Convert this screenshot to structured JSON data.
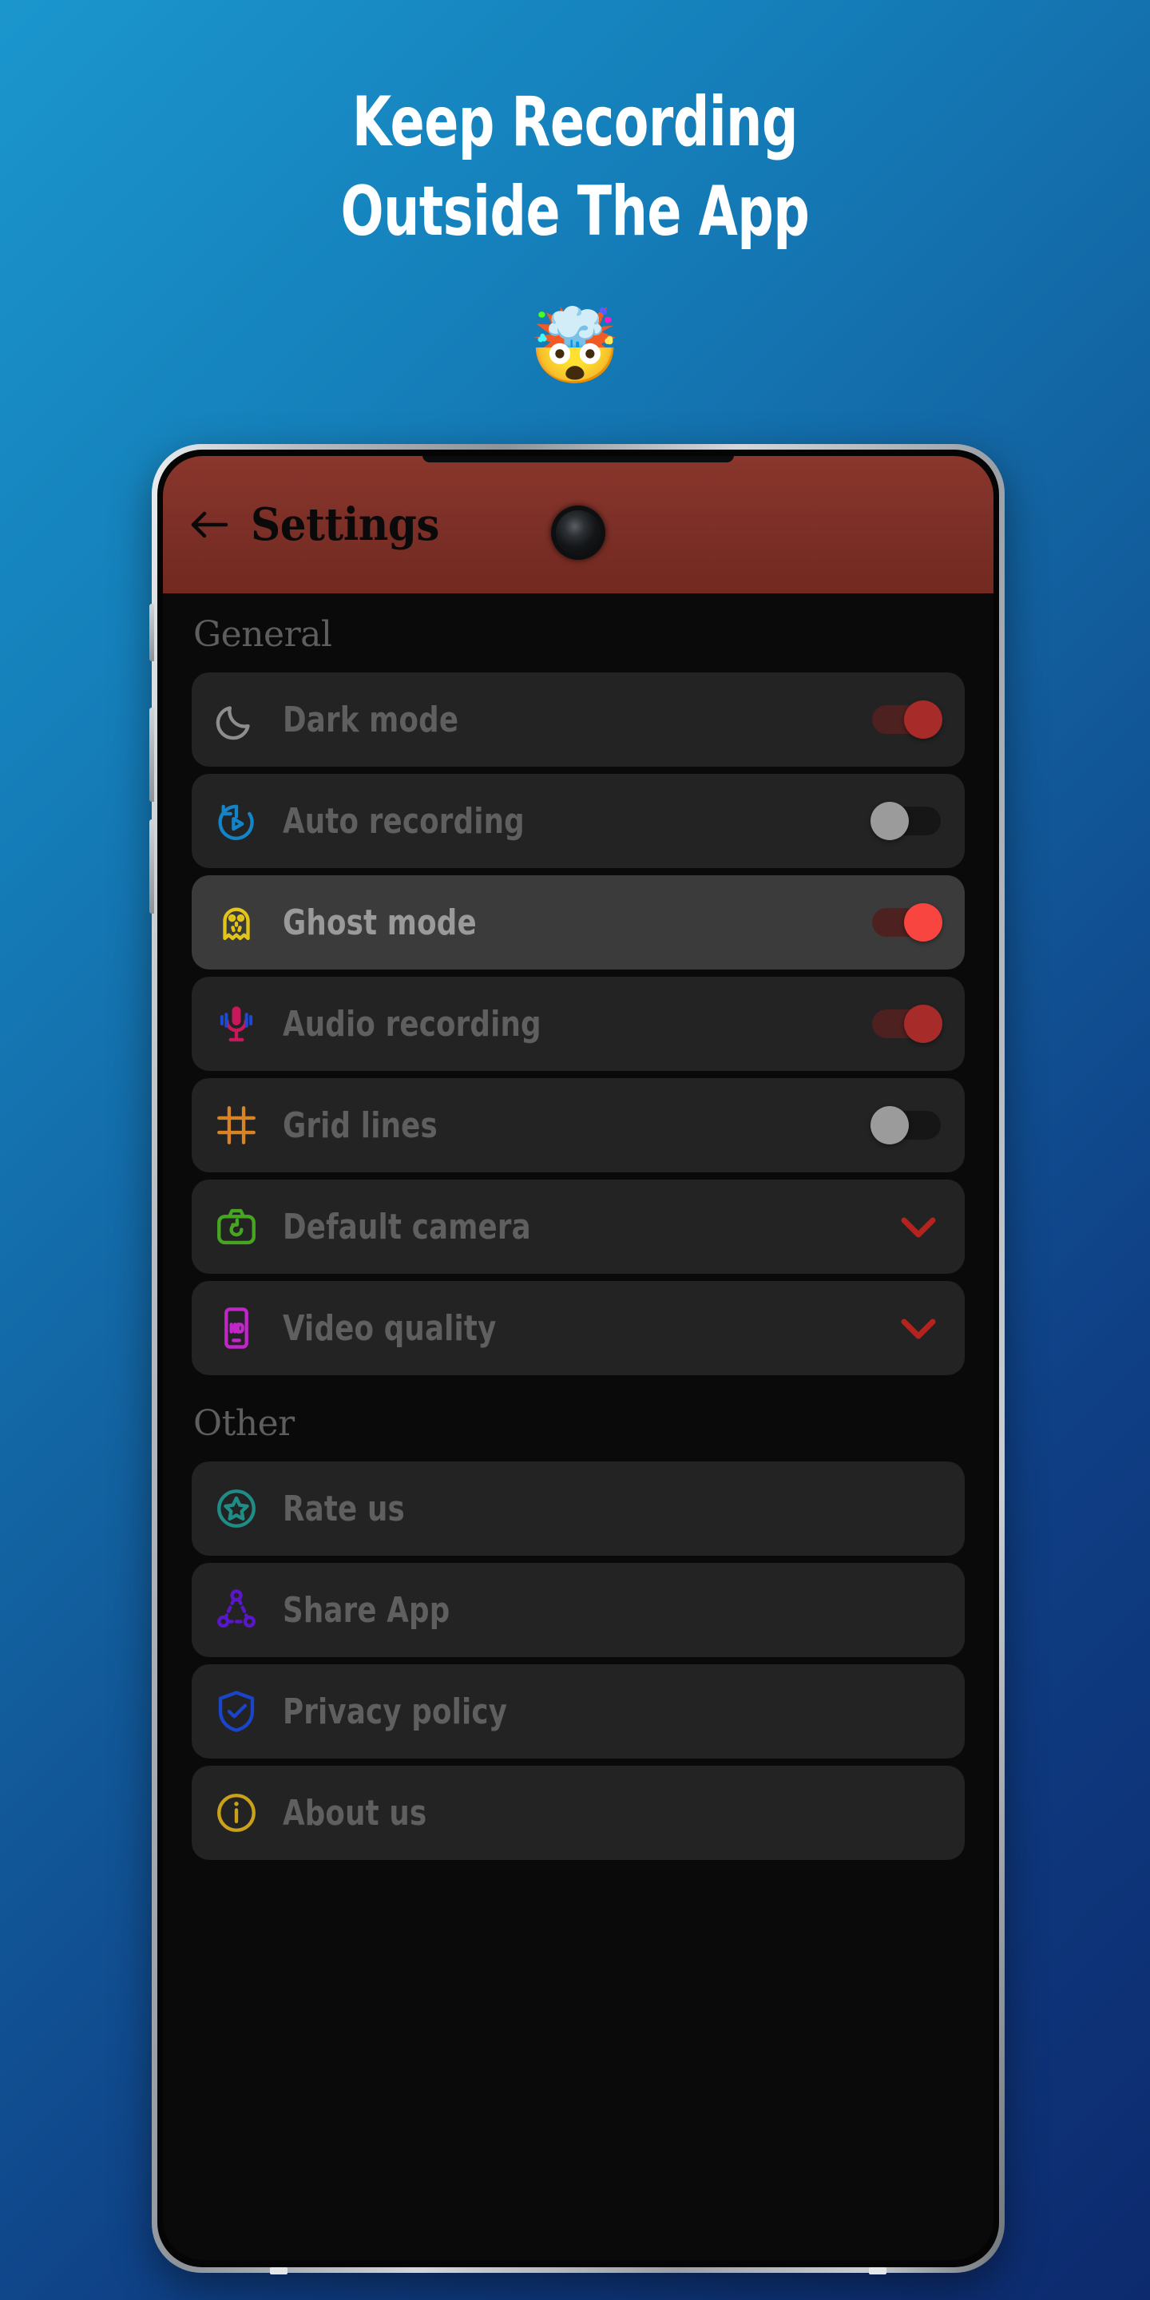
{
  "background": {
    "from": "#1b96cd",
    "to": "#0d2a6e"
  },
  "promo": {
    "headline_line1": "Keep Recording",
    "headline_line2": "Outside The App",
    "emoji": "🤯",
    "emoji_name": "exploding-head-emoji"
  },
  "appbar": {
    "title": "Settings",
    "back_icon": "back-arrow-icon",
    "background": "#7b2f27",
    "title_color": "#0a0a0a"
  },
  "colors": {
    "row_bg": "#232323",
    "row_bg_highlight": "#3b3b3b",
    "screen_bg": "#0a0a0a",
    "label": "#5f5f5f",
    "label_highlight": "#9a9a9a",
    "toggle_on_thumb": "#a72b29",
    "toggle_on_thumb_bright": "#f9453f",
    "toggle_on_track": "#4d211f",
    "toggle_off_thumb": "#9b9b9b",
    "toggle_off_track": "#161616",
    "chevron": "#b5231f"
  },
  "sections": [
    {
      "title": "General",
      "rows": [
        {
          "label": "Dark mode",
          "icon": "moon-icon",
          "icon_color": "#8d8d8d",
          "control": "toggle",
          "state": "on",
          "bright": false,
          "highlight": false
        },
        {
          "label": "Auto recording",
          "icon": "auto-record-icon",
          "icon_color": "#1484c8",
          "control": "toggle",
          "state": "off",
          "bright": false,
          "highlight": false
        },
        {
          "label": "Ghost mode",
          "icon": "ghost-icon",
          "icon_color": "#e3c517",
          "control": "toggle",
          "state": "on",
          "bright": true,
          "highlight": true
        },
        {
          "label": "Audio recording",
          "icon": "microphone-icon",
          "icon_color": "#c9175b",
          "control": "toggle",
          "state": "on",
          "bright": false,
          "highlight": false
        },
        {
          "label": "Grid lines",
          "icon": "grid-lines-icon",
          "icon_color": "#d88426",
          "control": "toggle",
          "state": "off",
          "bright": false,
          "highlight": false
        },
        {
          "label": "Default camera",
          "icon": "camera-icon",
          "icon_color": "#46a521",
          "control": "chevron",
          "state": "collapsed",
          "bright": false,
          "highlight": false
        },
        {
          "label": "Video quality",
          "icon": "video-quality-icon",
          "icon_color": "#c126c9",
          "control": "chevron",
          "state": "collapsed",
          "bright": false,
          "highlight": false
        }
      ]
    },
    {
      "title": "Other",
      "rows": [
        {
          "label": "Rate us",
          "icon": "star-circle-icon",
          "icon_color": "#1f8c86",
          "control": "none",
          "state": "",
          "bright": false,
          "highlight": false
        },
        {
          "label": "Share App",
          "icon": "share-nodes-icon",
          "icon_color": "#5a17c9",
          "control": "none",
          "state": "",
          "bright": false,
          "highlight": false
        },
        {
          "label": "Privacy policy",
          "icon": "shield-check-icon",
          "icon_color": "#1a44c9",
          "control": "none",
          "state": "",
          "bright": false,
          "highlight": false
        },
        {
          "label": "About us",
          "icon": "info-circle-icon",
          "icon_color": "#c9a11a",
          "control": "none",
          "state": "",
          "bright": false,
          "highlight": false
        }
      ]
    }
  ]
}
